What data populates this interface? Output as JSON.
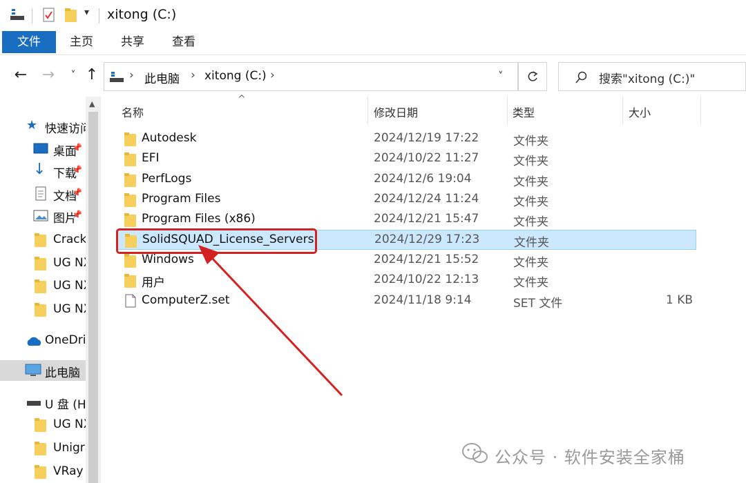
{
  "window": {
    "title": "xitong (C:)"
  },
  "ribbon": {
    "tabs": [
      "文件",
      "主页",
      "共享",
      "查看"
    ]
  },
  "address": {
    "crumbs": [
      "此电脑",
      "xitong (C:)"
    ],
    "search_placeholder": "搜索\"xitong (C:)\""
  },
  "nav": {
    "items": [
      {
        "label": "快速访问",
        "icon": "star-icon"
      },
      {
        "label": "桌面",
        "icon": "desktop-icon",
        "pinned": true
      },
      {
        "label": "下载",
        "icon": "download-icon",
        "pinned": true
      },
      {
        "label": "文档",
        "icon": "document-icon",
        "pinned": true
      },
      {
        "label": "图片",
        "icon": "picture-icon",
        "pinned": true
      },
      {
        "label": "Crack",
        "icon": "folder-icon"
      },
      {
        "label": "UG NX",
        "icon": "folder-icon"
      },
      {
        "label": "UG NX",
        "icon": "folder-icon"
      },
      {
        "label": "UG NX",
        "icon": "folder-icon"
      },
      {
        "label": "OneDrive",
        "icon": "cloud-icon"
      },
      {
        "label": "此电脑",
        "icon": "computer-icon"
      },
      {
        "label": "U 盘 (H:)",
        "icon": "drive-icon"
      },
      {
        "label": "UG NX",
        "icon": "folder-icon"
      },
      {
        "label": "Unigraphics",
        "icon": "folder-icon"
      },
      {
        "label": "VRay",
        "icon": "folder-icon"
      }
    ]
  },
  "columns": {
    "name": "名称",
    "date": "修改日期",
    "type": "类型",
    "size": "大小"
  },
  "files": [
    {
      "name": "Autodesk",
      "date": "2024/12/19 17:22",
      "type": "文件夹",
      "size": "",
      "kind": "folder"
    },
    {
      "name": "EFI",
      "date": "2024/10/22 11:27",
      "type": "文件夹",
      "size": "",
      "kind": "folder"
    },
    {
      "name": "PerfLogs",
      "date": "2024/12/6 19:04",
      "type": "文件夹",
      "size": "",
      "kind": "folder"
    },
    {
      "name": "Program Files",
      "date": "2024/12/24 11:24",
      "type": "文件夹",
      "size": "",
      "kind": "folder"
    },
    {
      "name": "Program Files (x86)",
      "date": "2024/12/21 15:47",
      "type": "文件夹",
      "size": "",
      "kind": "folder"
    },
    {
      "name": "SolidSQUAD_License_Servers",
      "date": "2024/12/29 17:23",
      "type": "文件夹",
      "size": "",
      "kind": "folder",
      "selected": true
    },
    {
      "name": "Windows",
      "date": "2024/12/21 15:52",
      "type": "文件夹",
      "size": "",
      "kind": "folder"
    },
    {
      "name": "用户",
      "date": "2024/10/22 12:13",
      "type": "文件夹",
      "size": "",
      "kind": "folder"
    },
    {
      "name": "ComputerZ.set",
      "date": "2024/11/18 9:14",
      "type": "SET 文件",
      "size": "1 KB",
      "kind": "file"
    }
  ],
  "watermark": {
    "text": "公众号 · 软件安装全家桶"
  },
  "colors": {
    "accent": "#1a6ec2",
    "selection": "#cce8ff",
    "annotation": "#d32222",
    "folder": "#f6cf5c"
  }
}
